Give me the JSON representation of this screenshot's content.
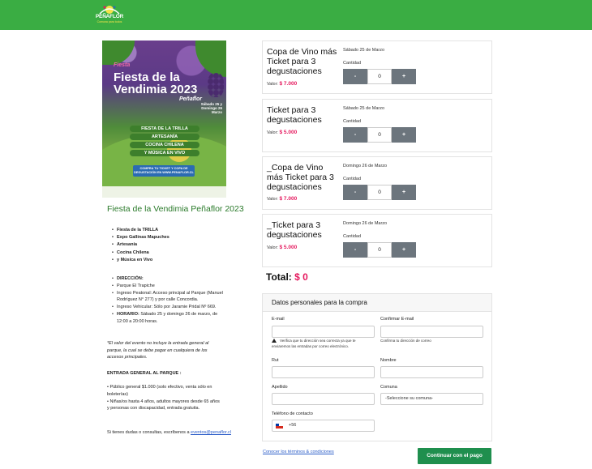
{
  "header": {
    "logo_text": "PEÑAFLOR",
    "logo_subtext": "Comuna para todos",
    "bg_color": "#3aad43"
  },
  "poster": {
    "small_title": "Fiesta",
    "big_title": "Fiesta de la Vendimia 2023",
    "subtitle": "Peñaflor",
    "dates": "Sábado 25 y Domingo 26 Marzo",
    "bars": [
      "FIESTA DE LA TRILLA",
      "ARTESANÍA",
      "COCINA CHILENA",
      "Y MÚSICA EN VIVO"
    ],
    "banner": "COMPRA TU TICKET Y COPA DE DEGUSTACIÓN EN WWW.PENAFLOR.CL"
  },
  "event": {
    "title": "Fiesta de la Vendimia Peñaflor 2023",
    "highlights": [
      "Fiesta de la TRILLA",
      "Expo Gallinas Mapuches",
      "Artesanía",
      "Cocina Chilena",
      "y Música en Vivo"
    ],
    "info": [
      {
        "label": "DIRECCIÓN:",
        "text": ""
      },
      {
        "label": "",
        "text": "Parque El Trapiche"
      },
      {
        "label": "",
        "text": "Ingreso Peatonal: Acceso principal al Parque (Manuel Rodríguez N° 277) y por calle Concordia."
      },
      {
        "label": "",
        "text": "Ingreso Vehicular: Sólo por Jaramie Pridal Nº 669."
      },
      {
        "label": "HORARIO:",
        "text": " Sábado 25 y domingo 26 de marzo, de 12:00 a 20:00 horas."
      }
    ],
    "note": "*El valor del evento no incluye la entrada general al parque, la cual se debe pagar en cualquiera de los accesos principales.",
    "general_heading": "ENTRADA GENERAL AL PARQUE :",
    "general_items": [
      "• Público general $1.000 (solo efectivo, venta sólo en boleterías)",
      "• Niñas/os hasta 4 años, adultos mayores desde 65 años y personas con discapacidad, entrada gratuita."
    ],
    "contact_text": "Si tienes dudas o consultas, escríbenos a",
    "contact_email": "eventos@penaflor.cl"
  },
  "tickets": [
    {
      "name": "Copa de Vino más Ticket para 3 degustaciones",
      "date": "Sábado 25 de Marzo",
      "price_label": "Valor:",
      "price": "$ 7.000",
      "qty_label": "Cantidad",
      "qty": "0",
      "minus": "-",
      "plus": "+"
    },
    {
      "name": "Ticket para 3 degustaciones",
      "date": "Sábado 25 de Marzo",
      "price_label": "Valor:",
      "price": "$ 5.000",
      "qty_label": "Cantidad",
      "qty": "0",
      "minus": "-",
      "plus": "+"
    },
    {
      "name": "_Copa de Vino más Ticket para 3 degustaciones",
      "date": "Domingo 26 de Marzo",
      "price_label": "Valor:",
      "price": "$ 7.000",
      "qty_label": "Cantidad",
      "qty": "0",
      "minus": "-",
      "plus": "+"
    },
    {
      "name": "_Ticket para 3 degustaciones",
      "date": "Domingo 26 de Marzo",
      "price_label": "Valor:",
      "price": "$ 5.000",
      "qty_label": "Cantidad",
      "qty": "0",
      "minus": "-",
      "plus": "+"
    }
  ],
  "total": {
    "label": "Total:",
    "amount": "$ 0"
  },
  "form": {
    "heading": "Datos personales para la compra",
    "email_label": "E-mail",
    "email_help": "Verifica que tu dirección sea correcta ya que te enviaremos las entradas por correo electrónico.",
    "confirm_label": "Confirmar E-mail",
    "confirm_help": "Confirma tu dirección de correo",
    "rut_label": "Rut",
    "name_label": "Nombre",
    "lastname_label": "Apellido",
    "comuna_label": "Comuna",
    "comuna_value": "-Seleccione su comuna-",
    "phone_label": "Teléfono de contacto",
    "phone_prefix": "+56"
  },
  "footer": {
    "terms_link": "Conocer los términos & condiciones",
    "pay_button": "Continuar con el pago"
  },
  "colors": {
    "accent": "#e5195e",
    "pay": "#1f8f4e",
    "stepper": "#6c757d",
    "title_green": "#2a7a2a"
  }
}
